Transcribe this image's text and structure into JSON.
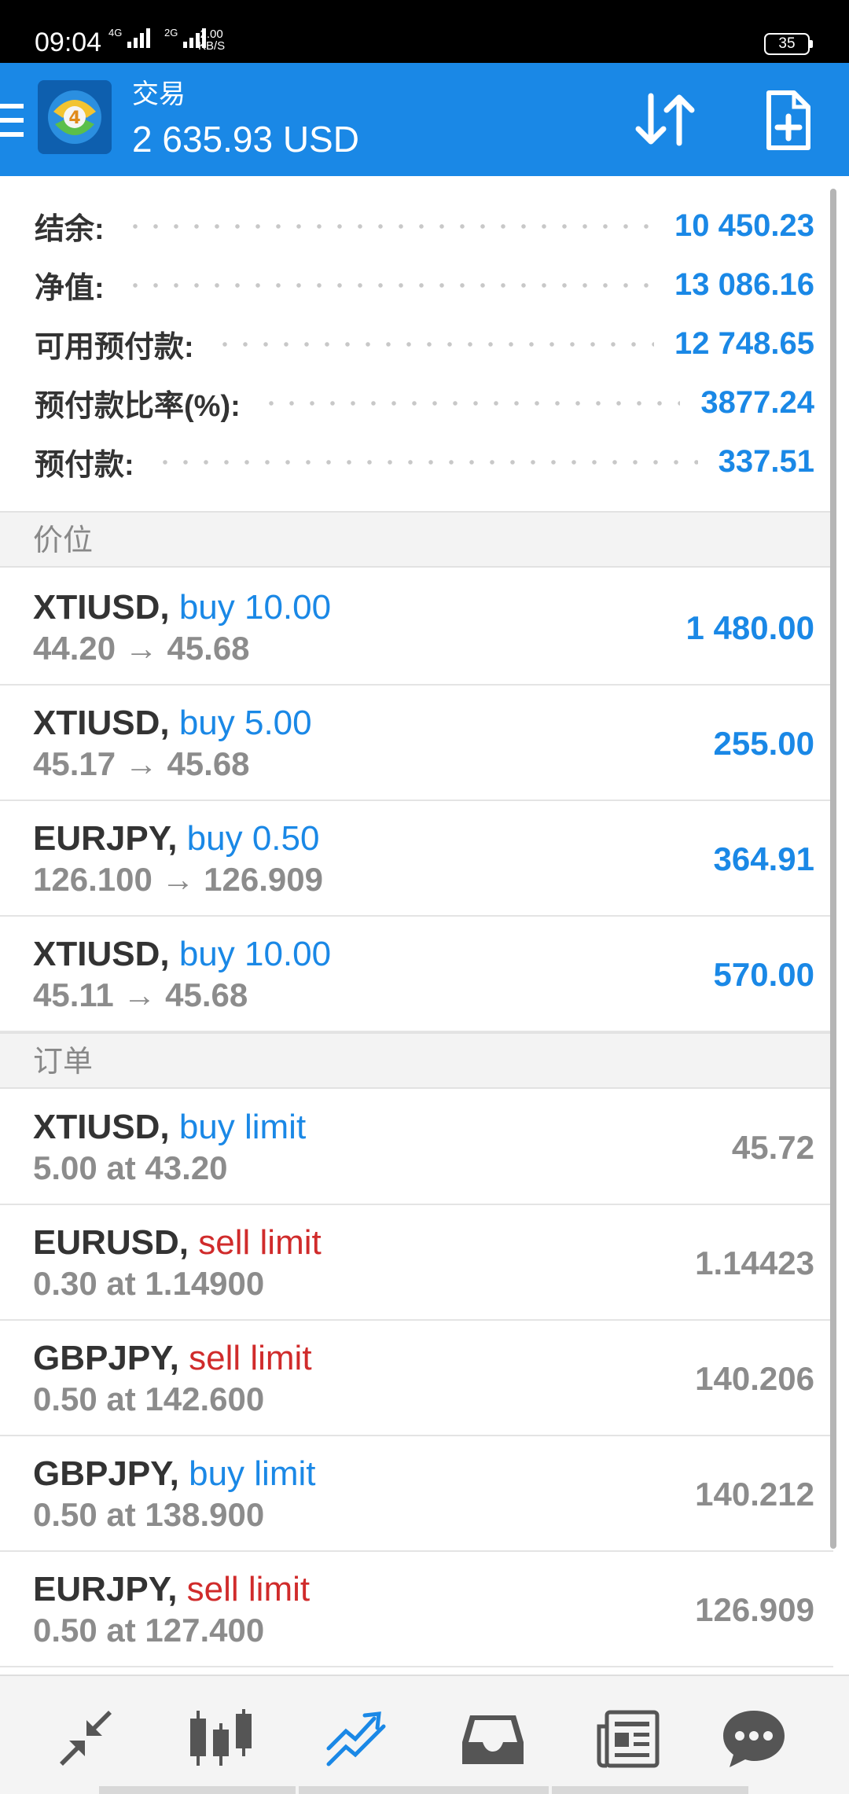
{
  "status_bar": {
    "time": "09:04",
    "signal1_label": "4G",
    "signal2_label": "2G",
    "speed_value": "2.00",
    "speed_unit": "KB/S",
    "battery": "35"
  },
  "app_bar": {
    "title": "交易",
    "balance": "2 635.93 USD"
  },
  "summary": [
    {
      "label": "结余:",
      "value": "10 450.23"
    },
    {
      "label": "净值:",
      "value": "13 086.16"
    },
    {
      "label": "可用预付款:",
      "value": "12 748.65"
    },
    {
      "label": "预付款比率(%):",
      "value": "3877.24"
    },
    {
      "label": "预付款:",
      "value": "337.51"
    }
  ],
  "positions_header": "价位",
  "positions": [
    {
      "symbol": "XTIUSD,",
      "side": "buy 10.00",
      "prices": "44.20 → 45.68",
      "profit": "1 480.00"
    },
    {
      "symbol": "XTIUSD,",
      "side": "buy 5.00",
      "prices": "45.17 → 45.68",
      "profit": "255.00"
    },
    {
      "symbol": "EURJPY,",
      "side": "buy 0.50",
      "prices": "126.100 → 126.909",
      "profit": "364.91"
    },
    {
      "symbol": "XTIUSD,",
      "side": "buy 10.00",
      "prices": "45.11 → 45.68",
      "profit": "570.00"
    }
  ],
  "orders_header": "订单",
  "orders": [
    {
      "symbol": "XTIUSD,",
      "type": "buy limit",
      "detail": "5.00 at 43.20",
      "price": "45.72"
    },
    {
      "symbol": "EURUSD,",
      "type": "sell limit",
      "detail": "0.30 at 1.14900",
      "price": "1.14423"
    },
    {
      "symbol": "GBPJPY,",
      "type": "sell limit",
      "detail": "0.50 at 142.600",
      "price": "140.206"
    },
    {
      "symbol": "GBPJPY,",
      "type": "buy limit",
      "detail": "0.50 at 138.900",
      "price": "140.212"
    },
    {
      "symbol": "EURJPY,",
      "type": "sell limit",
      "detail": "0.50 at 127.400",
      "price": "126.909"
    }
  ],
  "bottom_nav": [
    {
      "icon": "quotes-icon"
    },
    {
      "icon": "chart-icon"
    },
    {
      "icon": "trade-icon",
      "active": true
    },
    {
      "icon": "history-icon"
    },
    {
      "icon": "news-icon"
    },
    {
      "icon": "chat-icon"
    }
  ],
  "colors": {
    "accent": "#1a88e6",
    "sell": "#d02b2b",
    "statusbar": "#000000"
  }
}
